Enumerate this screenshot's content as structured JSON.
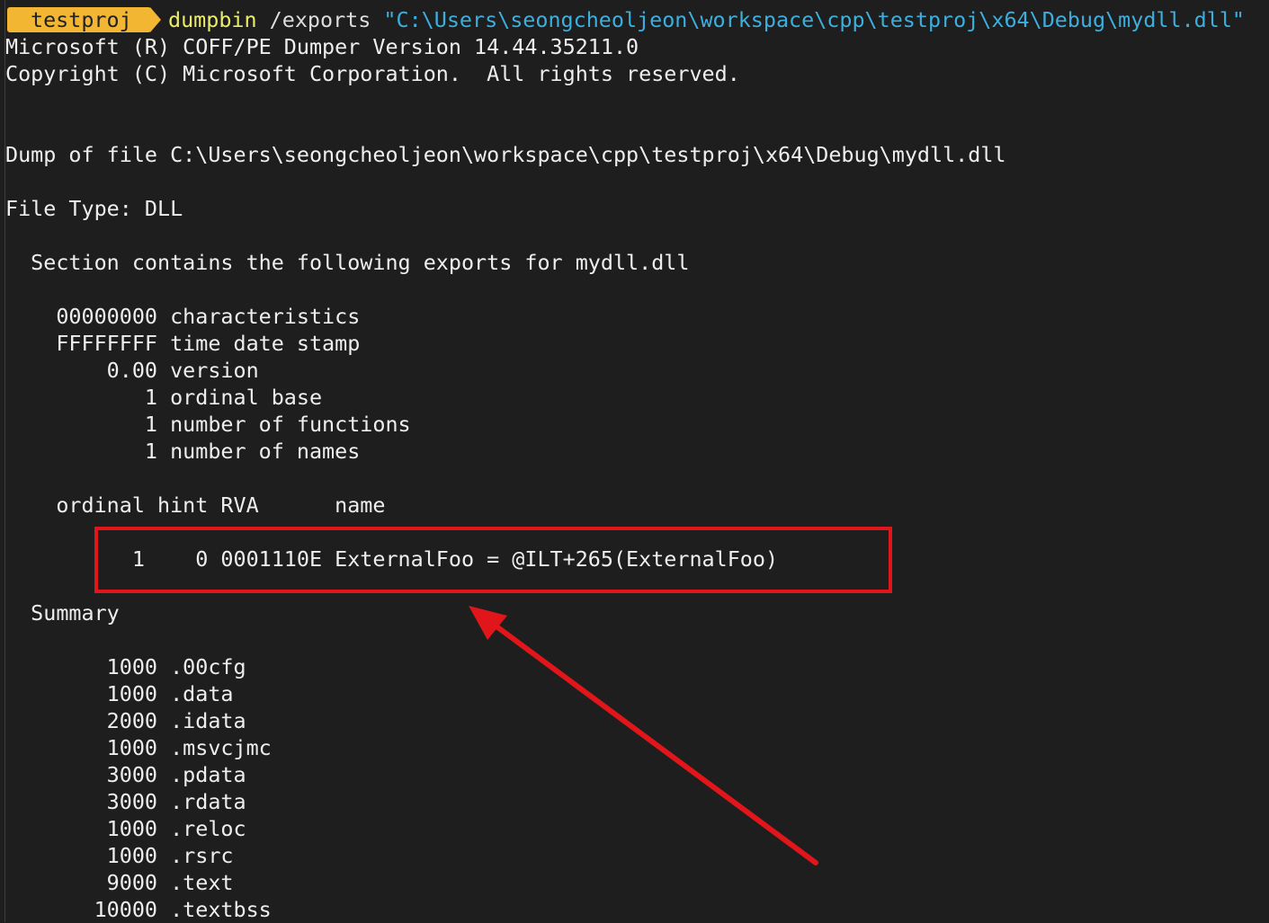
{
  "prompt": {
    "directory": "testproj",
    "command": "dumpbin",
    "option": " /exports ",
    "path_arg": "\"C:\\Users\\seongcheoljeon\\workspace\\cpp\\testproj\\x64\\Debug\\mydll.dll\""
  },
  "output": {
    "version_line": "Microsoft (R) COFF/PE Dumper Version 14.44.35211.0",
    "copyright_line": "Copyright (C) Microsoft Corporation.  All rights reserved.",
    "dump_line": "Dump of file C:\\Users\\seongcheoljeon\\workspace\\cpp\\testproj\\x64\\Debug\\mydll.dll",
    "file_type_line": "File Type: DLL",
    "section_line": "  Section contains the following exports for mydll.dll",
    "header_fields": [
      "    00000000 characteristics",
      "    FFFFFFFF time date stamp",
      "        0.00 version",
      "           1 ordinal base",
      "           1 number of functions",
      "           1 number of names"
    ],
    "table_header": "    ordinal hint RVA      name",
    "export_entry": "          1    0 0001110E ExternalFoo = @ILT+265(ExternalFoo)",
    "summary_title": "  Summary",
    "summary_rows": [
      "        1000 .00cfg",
      "        1000 .data",
      "        2000 .idata",
      "        1000 .msvcjmc",
      "        3000 .pdata",
      "        3000 .rdata",
      "        1000 .reloc",
      "        1000 .rsrc",
      "        9000 .text",
      "       10000 .textbss"
    ]
  },
  "annotation": {
    "color": "#e0161b"
  },
  "theme": {
    "background": "#1e1e1e",
    "prompt_tag_bg": "#f3b633",
    "command_color": "#ecec6a",
    "path_color": "#3bb0e0"
  }
}
